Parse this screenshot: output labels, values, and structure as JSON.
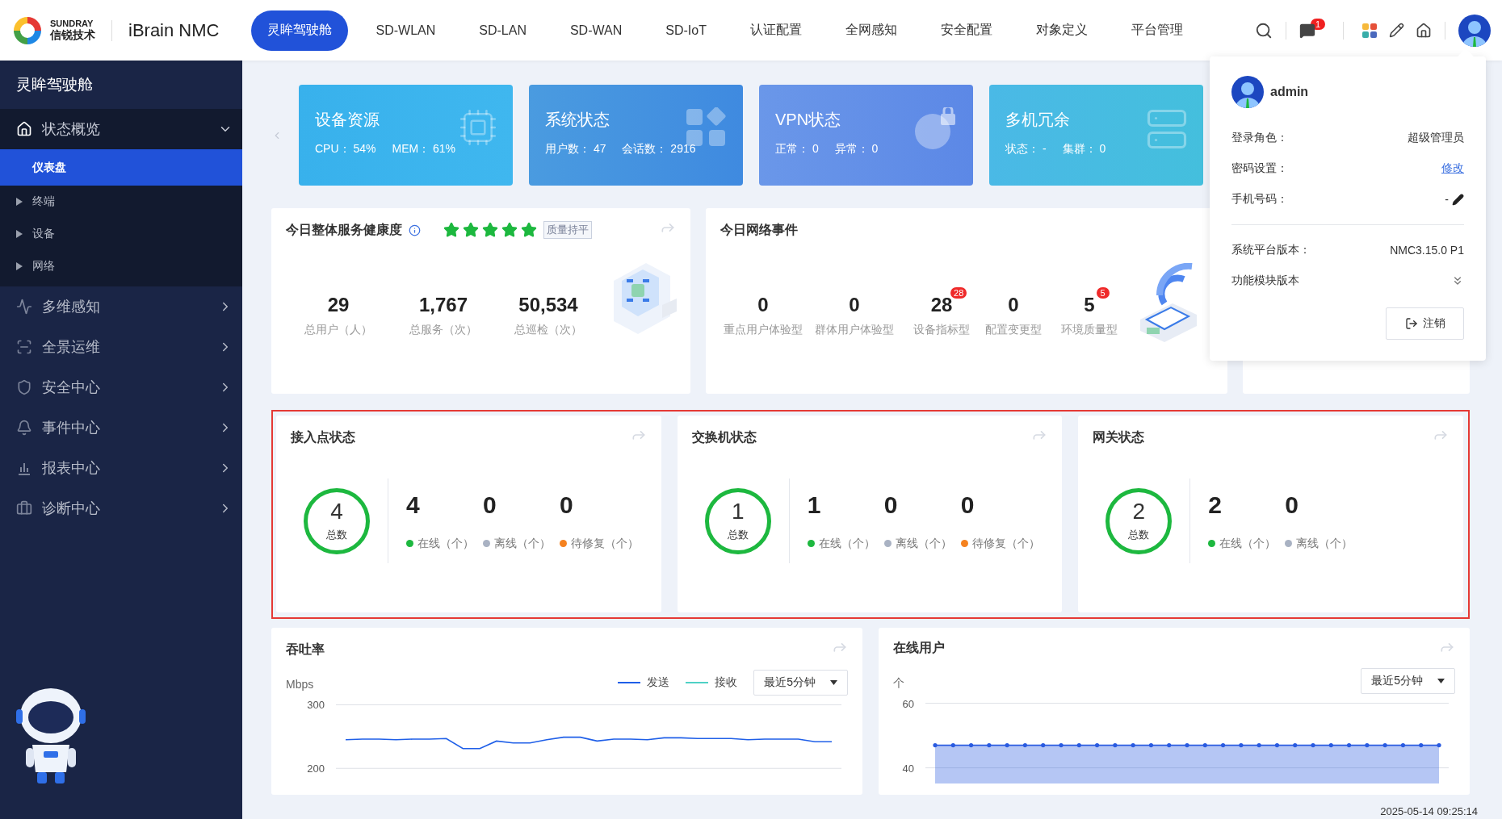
{
  "header": {
    "brand": "SUNDRAY",
    "brand_sub": "信锐技术",
    "product": "iBrain NMC",
    "nav": [
      {
        "label": "灵眸驾驶舱",
        "selected": true
      },
      {
        "label": "SD-WLAN",
        "selected": false
      },
      {
        "label": "SD-LAN",
        "selected": false
      },
      {
        "label": "SD-WAN",
        "selected": false
      },
      {
        "label": "SD-IoT",
        "selected": false
      },
      {
        "label": "认证配置",
        "selected": false
      },
      {
        "label": "全网感知",
        "selected": false
      },
      {
        "label": "安全配置",
        "selected": false
      },
      {
        "label": "对象定义",
        "selected": false
      },
      {
        "label": "平台管理",
        "selected": false
      }
    ],
    "message_count": "1"
  },
  "sidebar": {
    "title": "灵眸驾驶舱",
    "items": [
      {
        "label": "状态概览",
        "expanded": true,
        "children": [
          {
            "label": "仪表盘",
            "kind": "page",
            "selected": true
          },
          {
            "label": "终端",
            "kind": "group",
            "selected": false
          },
          {
            "label": "设备",
            "kind": "group",
            "selected": false
          },
          {
            "label": "网络",
            "kind": "group",
            "selected": false
          }
        ]
      },
      {
        "label": "多维感知",
        "expanded": false
      },
      {
        "label": "全景运维",
        "expanded": false
      },
      {
        "label": "安全中心",
        "expanded": false
      },
      {
        "label": "事件中心",
        "expanded": false
      },
      {
        "label": "报表中心",
        "expanded": false
      },
      {
        "label": "诊断中心",
        "expanded": false
      }
    ]
  },
  "summary_cards": [
    {
      "title": "设备资源",
      "stats": [
        {
          "label": "CPU：",
          "value": "54%"
        },
        {
          "label": "MEM：",
          "value": "61%"
        }
      ]
    },
    {
      "title": "系统状态",
      "stats": [
        {
          "label": "用户数：",
          "value": "47"
        },
        {
          "label": "会话数：",
          "value": "2916"
        }
      ]
    },
    {
      "title": "VPN状态",
      "stats": [
        {
          "label": "正常：",
          "value": "0"
        },
        {
          "label": "异常：",
          "value": "0"
        }
      ]
    },
    {
      "title": "多机冗余",
      "stats": [
        {
          "label": "状态：",
          "value": "-"
        },
        {
          "label": "集群：",
          "value": "0"
        }
      ]
    }
  ],
  "health": {
    "title": "今日整体服务健康度",
    "stars": 5,
    "badge": "质量持平",
    "metrics": [
      {
        "value": "29",
        "label": "总用户（人）"
      },
      {
        "value": "1,767",
        "label": "总服务（次）"
      },
      {
        "value": "50,534",
        "label": "总巡检（次）"
      }
    ]
  },
  "events": {
    "title": "今日网络事件",
    "metrics": [
      {
        "value": "0",
        "label": "重点用户体验型"
      },
      {
        "value": "0",
        "label": "群体用户体验型"
      },
      {
        "value": "28",
        "label": "设备指标型",
        "badge": "28"
      },
      {
        "value": "0",
        "label": "配置变更型"
      },
      {
        "value": "5",
        "label": "环境质量型",
        "badge": "5"
      }
    ]
  },
  "device_status": {
    "highlighted": true,
    "cards": [
      {
        "title": "接入点状态",
        "total": "4",
        "total_label": "总数",
        "counts": [
          {
            "value": "4",
            "label": "在线（个）",
            "color": "#1db83f"
          },
          {
            "value": "0",
            "label": "离线（个）",
            "color": "#a9b2c3"
          },
          {
            "value": "0",
            "label": "待修复（个）",
            "color": "#f5821f"
          }
        ]
      },
      {
        "title": "交换机状态",
        "total": "1",
        "total_label": "总数",
        "counts": [
          {
            "value": "1",
            "label": "在线（个）",
            "color": "#1db83f"
          },
          {
            "value": "0",
            "label": "离线（个）",
            "color": "#a9b2c3"
          },
          {
            "value": "0",
            "label": "待修复（个）",
            "color": "#f5821f"
          }
        ]
      },
      {
        "title": "网关状态",
        "total": "2",
        "total_label": "总数",
        "counts": [
          {
            "value": "2",
            "label": "在线（个）",
            "color": "#1db83f"
          },
          {
            "value": "0",
            "label": "离线（个）",
            "color": "#a9b2c3"
          }
        ]
      }
    ]
  },
  "throughput": {
    "title": "吞吐率",
    "range": "最近5分钟",
    "chart_data": {
      "type": "line",
      "ylabel": "Mbps",
      "ylim": [
        200,
        300
      ],
      "yticks": [
        200,
        300
      ],
      "series": [
        {
          "name": "发送",
          "color": "#1f5fe8",
          "values": [
            245,
            246,
            246,
            245,
            246,
            246,
            247,
            231,
            231,
            243,
            240,
            240,
            245,
            249,
            249,
            243,
            246,
            246,
            245,
            248,
            248,
            247,
            247,
            247,
            245,
            246,
            246,
            246,
            242,
            242
          ]
        },
        {
          "name": "接收",
          "color": "#4fd1c5"
        }
      ]
    }
  },
  "online_users": {
    "title": "在线用户",
    "range": "最近5分钟",
    "chart_data": {
      "type": "area",
      "ylabel": "个",
      "ylim": [
        40,
        60
      ],
      "yticks": [
        40,
        60
      ],
      "series": [
        {
          "color": "#2a5be0",
          "values": [
            47,
            47,
            47,
            47,
            47,
            47,
            47,
            47,
            47,
            47,
            47,
            47,
            47,
            47,
            47,
            47,
            47,
            47,
            47,
            47,
            47,
            47,
            47,
            47,
            47,
            47,
            47,
            47,
            47
          ]
        }
      ]
    }
  },
  "timestamp": "2025-05-14 09:25:14",
  "user_popover": {
    "user": "admin",
    "rows": [
      {
        "label": "登录角色：",
        "value": "超级管理员",
        "kind": "text"
      },
      {
        "label": "密码设置：",
        "value": "修改",
        "kind": "link"
      },
      {
        "label": "手机号码：",
        "value": "-",
        "kind": "editable"
      }
    ],
    "version": {
      "label": "系统平台版本：",
      "value": "NMC3.15.0 P1"
    },
    "modules": {
      "label": "功能模块版本",
      "expanded": false
    },
    "logout": "注销"
  }
}
